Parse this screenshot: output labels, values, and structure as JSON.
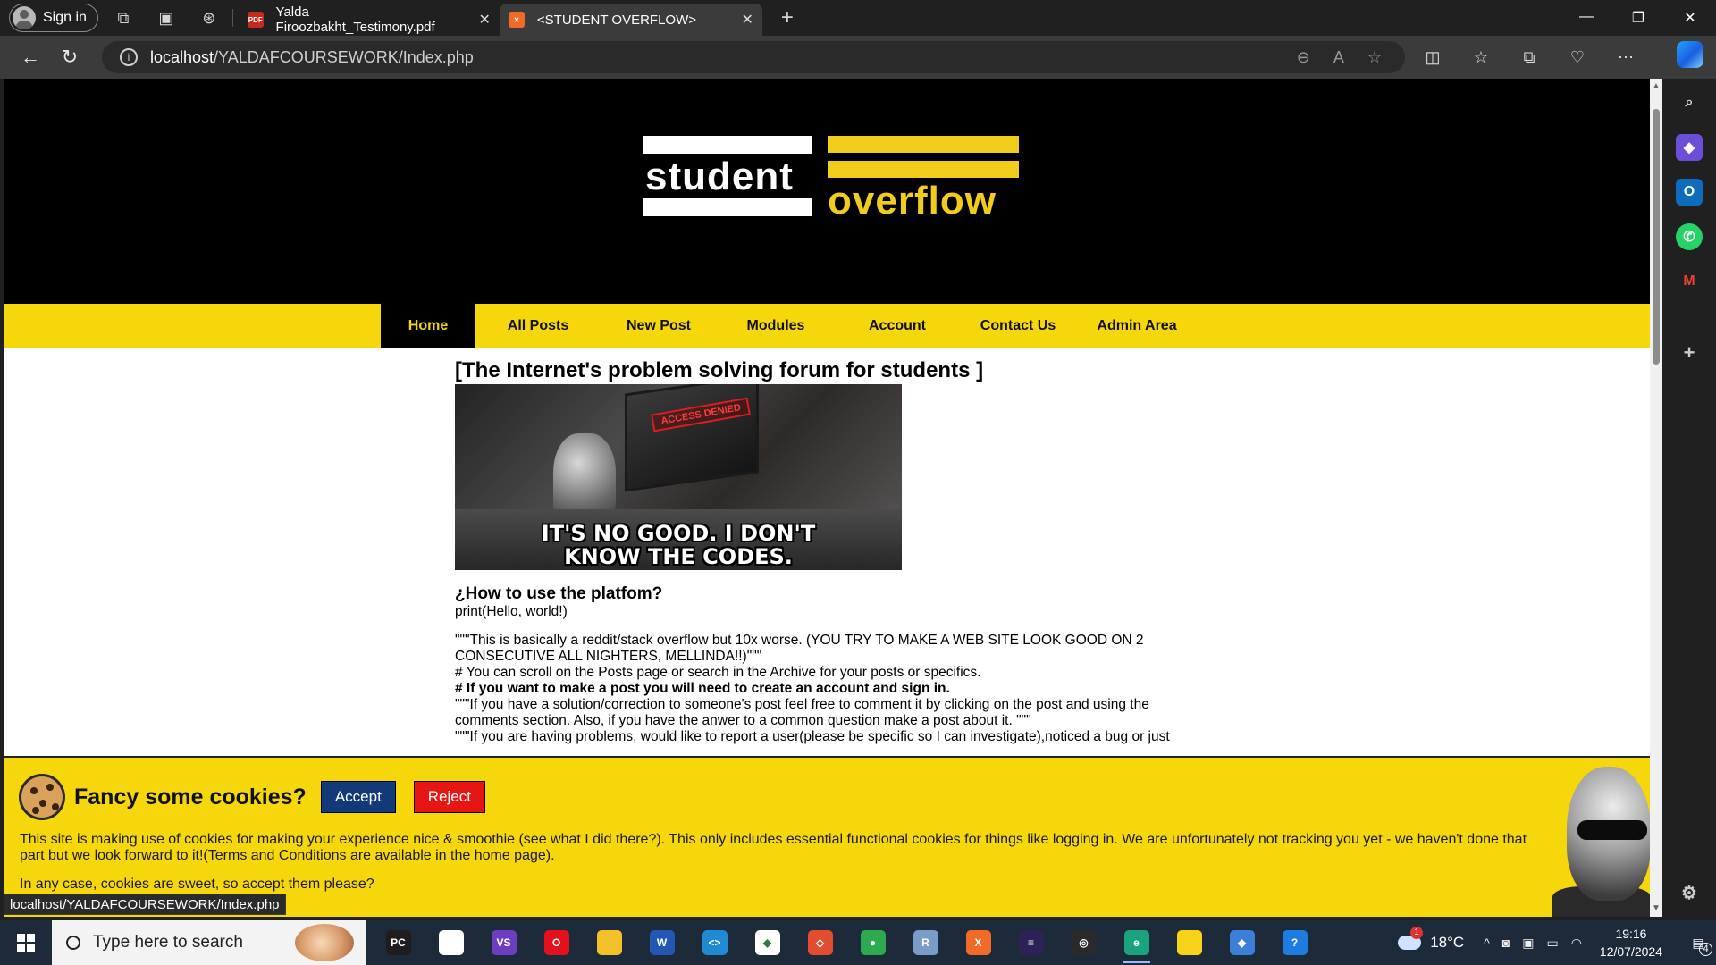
{
  "browser": {
    "signin_label": "Sign in",
    "tabs": [
      {
        "title": "Yalda Firoozbakht_Testimony.pdf",
        "favicon": "pdf-icon",
        "active": false
      },
      {
        "title": "<STUDENT OVERFLOW>",
        "favicon": "xampp-icon",
        "active": true
      }
    ],
    "url_host": "localhost",
    "url_path": "/YALDAFCOURSEWORK/Index.php",
    "status_url": "localhost/YALDAFCOURSEWORK/Index.php"
  },
  "site": {
    "logo_word1": "student",
    "logo_word2": "overflow",
    "nav": [
      {
        "label": "Home",
        "active": true
      },
      {
        "label": "All Posts",
        "active": false
      },
      {
        "label": "New Post",
        "active": false
      },
      {
        "label": "Modules",
        "active": false
      },
      {
        "label": "Account",
        "active": false
      },
      {
        "label": "Contact Us",
        "active": false
      },
      {
        "label": "Admin Area",
        "active": false
      }
    ],
    "heading": "[The Internet's problem solving forum for students ]",
    "meme_caption_line1": "IT'S NO GOOD. I DON'T",
    "meme_caption_line2": "KNOW THE CODES.",
    "meme_screen_label": "ACCESS DENIED",
    "howto_title": "¿How to use the platfom?",
    "howto_lines": [
      "print(Hello, world!)",
      "\"\"\"This is basically a reddit/stack overflow but 10x worse. (YOU TRY TO MAKE A WEB SITE LOOK GOOD ON 2 CONSECUTIVE ALL NIGHTERS, MELLINDA!!)\"\"\"",
      "# You can scroll on the Posts page or search in the Archive for your posts or specifics.",
      "# If you want to make a post you will need to create an account and sign in.",
      "\"\"\"If you have a solution/correction to someone's post feel free to comment it by clicking on the post and using the comments section. Also, if you have the anwer to a common question make a post about it. \"\"\"",
      "\"\"\"If you are having problems, would like to report a user(please be specific so I can investigate),noticed a bug or just"
    ]
  },
  "cookie_banner": {
    "title": "Fancy some cookies?",
    "accept_label": "Accept",
    "reject_label": "Reject",
    "body": "This site is making use of cookies for making your experience nice & smoothie (see what I did there?). This only includes essential functional cookies for things like logging in. We are unfortunately not tracking you yet - we haven't done that part but we look forward to it!(Terms and Conditions are available in the home page).",
    "footer": "In any case, cookies are sweet, so accept them please?"
  },
  "taskbar": {
    "search_placeholder": "Type here to search",
    "apps": [
      {
        "name": "pycharm-icon",
        "label": "PC",
        "color": "#1d1d1d",
        "running": false
      },
      {
        "name": "notepad-icon",
        "label": "",
        "color": "#ffffff",
        "running": false
      },
      {
        "name": "visual-studio-icon",
        "label": "VS",
        "color": "#6c3fc1",
        "running": false
      },
      {
        "name": "opera-icon",
        "label": "O",
        "color": "#e4111d",
        "running": false
      },
      {
        "name": "file-explorer-icon",
        "label": "",
        "color": "#f3c02a",
        "running": false
      },
      {
        "name": "word-icon",
        "label": "W",
        "color": "#2258b4",
        "running": false
      },
      {
        "name": "vscode-icon",
        "label": "<>",
        "color": "#1f8ad2",
        "running": false
      },
      {
        "name": "mongodb-icon",
        "label": "◆",
        "color": "#ffffff",
        "running": false
      },
      {
        "name": "git-icon",
        "label": "◇",
        "color": "#e24d2f",
        "running": false
      },
      {
        "name": "chrome-icon",
        "label": "●",
        "color": "#2da94f",
        "running": false
      },
      {
        "name": "r-icon",
        "label": "R",
        "color": "#7a9cc9",
        "running": false
      },
      {
        "name": "xampp-icon",
        "label": "X",
        "color": "#f26a28",
        "running": false
      },
      {
        "name": "eclipse-icon",
        "label": "≡",
        "color": "#2c2255",
        "running": false
      },
      {
        "name": "obs-icon",
        "label": "◎",
        "color": "#2a2a2a",
        "running": false
      },
      {
        "name": "edge-icon",
        "label": "e",
        "color": "#1aa37d",
        "running": true
      },
      {
        "name": "sticky-notes-icon",
        "label": "",
        "color": "#f7d417",
        "running": false
      },
      {
        "name": "sourcetree-icon",
        "label": "◆",
        "color": "#3b7fd9",
        "running": false
      },
      {
        "name": "help-icon",
        "label": "?",
        "color": "#1e7be0",
        "running": false
      }
    ],
    "weather_temp": "18°C",
    "weather_badge": "1",
    "time": "19:16",
    "date": "12/07/2024",
    "notifications_count": "4"
  }
}
